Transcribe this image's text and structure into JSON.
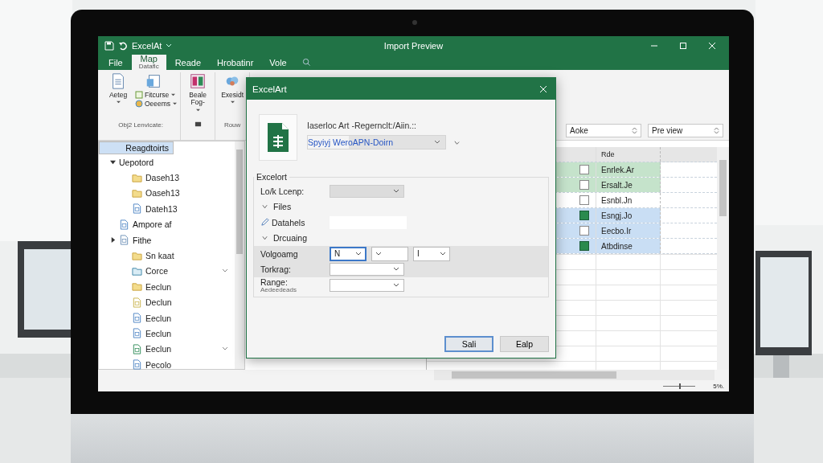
{
  "window": {
    "app_name": "ExcelAt",
    "title": "Import Preview"
  },
  "tabs": [
    {
      "label": "File",
      "selected": false
    },
    {
      "label": "Map",
      "sublabel": "Dataflc",
      "selected": true
    },
    {
      "label": "Reade",
      "selected": false
    },
    {
      "label": "Hrobatinr",
      "selected": false
    },
    {
      "label": "Vole",
      "selected": false
    }
  ],
  "ribbon": {
    "groups": [
      {
        "label": "Obj2 Lenvicate:",
        "items": [
          {
            "kind": "large",
            "label": "Aeteg"
          },
          {
            "kind": "stack",
            "labels": [
              "Fitcurse",
              "Oeeems"
            ]
          }
        ]
      },
      {
        "items": [
          {
            "kind": "large",
            "label": "Beale Fog-"
          }
        ]
      },
      {
        "label": "Rouw",
        "items": [
          {
            "kind": "large",
            "label": "Exesidt"
          }
        ]
      }
    ],
    "fields": [
      {
        "value": "Aoke"
      },
      {
        "value": "Pre view"
      }
    ]
  },
  "tree": [
    {
      "label": "Reagdtoirts",
      "kind": "none",
      "selected": true,
      "chevron": false
    },
    {
      "label": "Uepotord",
      "kind": "none",
      "selected": false,
      "chevron": false,
      "expanded": true,
      "children": [
        {
          "label": "Daseh13",
          "kind": "folder",
          "selected": false,
          "chevron": false
        },
        {
          "label": "Oaseh13",
          "kind": "folder",
          "selected": false,
          "chevron": false
        },
        {
          "label": "Dateh13",
          "kind": "doc",
          "selected": false,
          "chevron": false
        }
      ]
    },
    {
      "label": "Ampore af",
      "kind": "doc",
      "selected": false,
      "chevron": false
    },
    {
      "label": "Fithe",
      "kind": "file",
      "selected": false,
      "chevron": false,
      "children": [
        {
          "label": "Sn kaat",
          "kind": "folder",
          "selected": false,
          "chevron": false
        },
        {
          "label": "Corce",
          "kind": "openfolder",
          "selected": false,
          "chevron": true
        },
        {
          "label": "Eeclun",
          "kind": "folder",
          "selected": false,
          "chevron": false
        },
        {
          "label": "Declun",
          "kind": "note",
          "selected": false,
          "chevron": false
        },
        {
          "label": "Eeclun",
          "kind": "doc",
          "selected": false,
          "chevron": false
        },
        {
          "label": "Eeclun",
          "kind": "doc",
          "selected": false,
          "chevron": false
        },
        {
          "label": "Eeclun",
          "kind": "sheet",
          "selected": false,
          "chevron": true
        },
        {
          "label": "Pecolo",
          "kind": "doc",
          "selected": false,
          "chevron": false
        }
      ]
    }
  ],
  "grid": {
    "column_2": "Rde",
    "rows": [
      {
        "text": "Enrlek.Ar",
        "checked": false,
        "color": "#c5e3cb"
      },
      {
        "text": "Ersalt.Je",
        "checked": false,
        "color": "#c5e3cb"
      },
      {
        "text": "Esnbl.Jn",
        "checked": false,
        "color": "#ffffff"
      },
      {
        "text": "Esngj.Jo",
        "checked": true,
        "color": "#c9def4"
      },
      {
        "text": "Eecbo.Ir",
        "checked": false,
        "color": "#c9def4"
      },
      {
        "text": "Atbdinse",
        "checked": true,
        "color": "#c9def4"
      }
    ]
  },
  "status_bar": {
    "zoom": {
      "level": 0.5
    },
    "text": "5%."
  },
  "dialog": {
    "title": "ExcelArt",
    "message": "Iaserloc Art -Regernclt:/Aiin.::",
    "link": "Spyiyj WeroAPN-Doirn",
    "group_title": "Excelort",
    "rows": [
      {
        "kind": "select",
        "label": "Lo/k Lcenp:",
        "disabled": true,
        "shaded": false
      },
      {
        "kind": "expander",
        "label": "Files",
        "shaded": false
      },
      {
        "kind": "text",
        "label": "Datahels",
        "shaded": false
      },
      {
        "kind": "expander",
        "label": "Drcuaing",
        "shaded": false
      },
      {
        "kind": "combos",
        "label": "Volgoamg",
        "shaded": true,
        "combos": [
          {
            "value": "N",
            "focused": true
          },
          {
            "focused": false
          },
          {
            "value": "I",
            "focused": false
          }
        ]
      },
      {
        "kind": "select",
        "label": "Torkrag:",
        "disabled": false,
        "shaded": true
      },
      {
        "kind": "select",
        "label": "Range:",
        "hint": "Aedeedeads",
        "disabled": false,
        "shaded": false
      }
    ],
    "buttons": [
      {
        "label": "Sali",
        "default": true
      },
      {
        "label": "Ealp",
        "default": false
      }
    ]
  }
}
